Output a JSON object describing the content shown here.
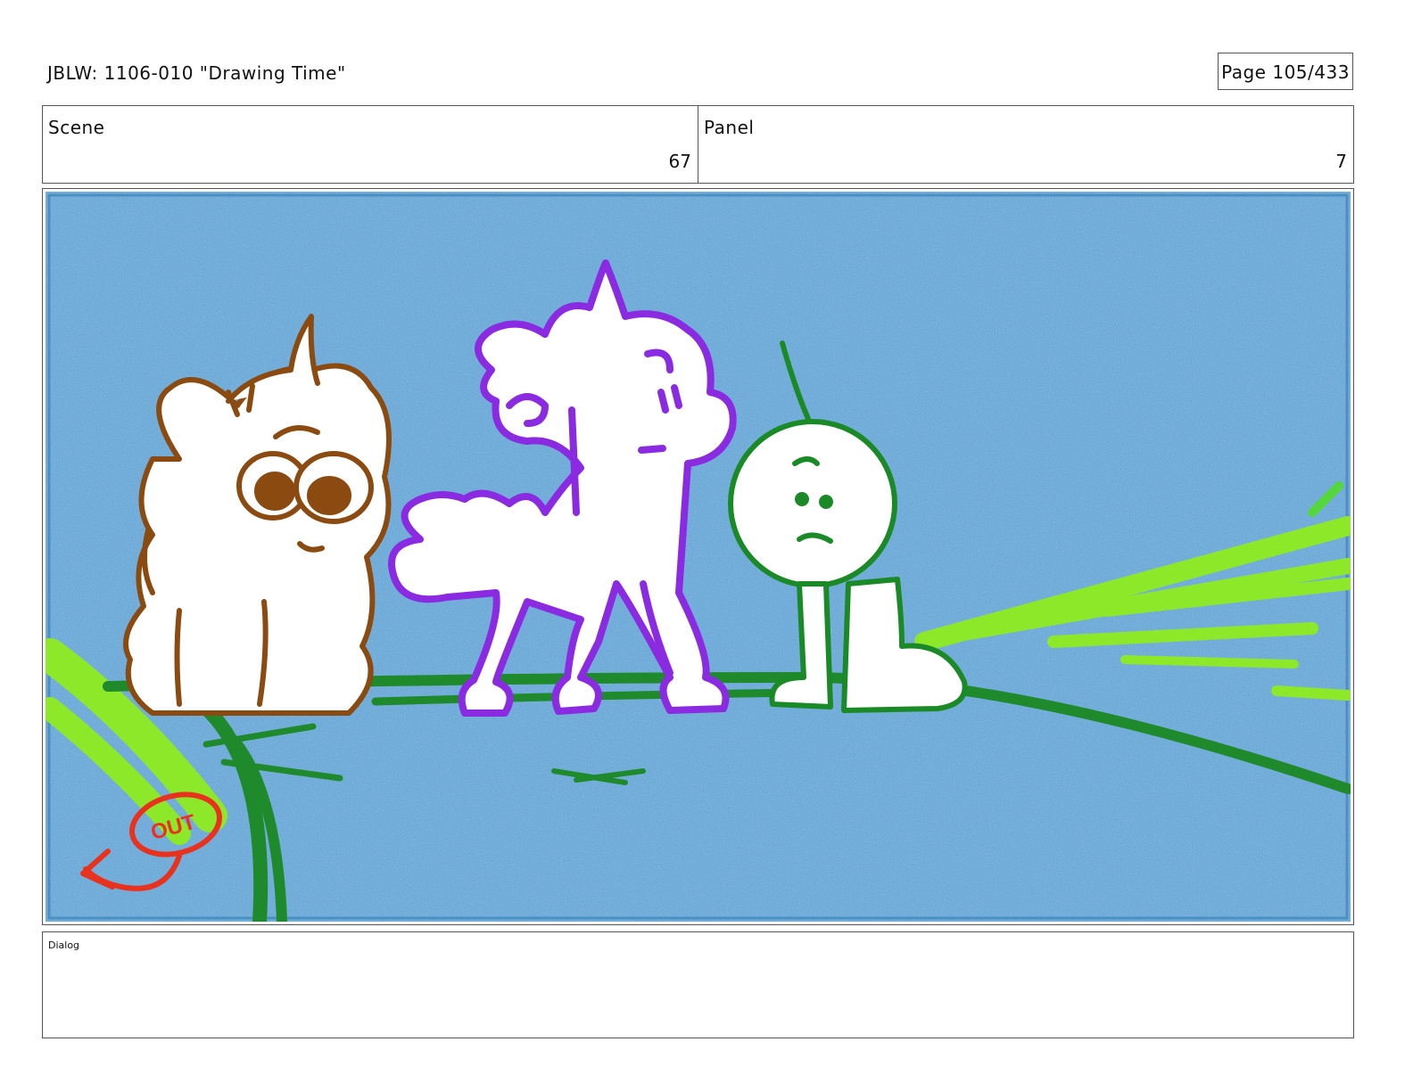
{
  "header": {
    "doc_title": "JBLW: 1106-010 \"Drawing Time\"",
    "page": "Page 105/433"
  },
  "info": {
    "scene_label": "Scene",
    "scene_value": "67",
    "panel_label": "Panel",
    "panel_value": "7"
  },
  "frame": {
    "annotation": "OUT",
    "colors": {
      "sky": "#4a9fd4",
      "ground_line": "#1f8a2c",
      "grass": "#8ee82a",
      "bear": "#8b4a10",
      "unicorn": "#8a2be2",
      "stick_figure": "#1a8a26",
      "annotation": "#e8321e"
    },
    "characters": [
      "bear-unicorn",
      "white-unicorn",
      "stick-figure"
    ]
  },
  "dialog": {
    "label": "Dialog"
  }
}
